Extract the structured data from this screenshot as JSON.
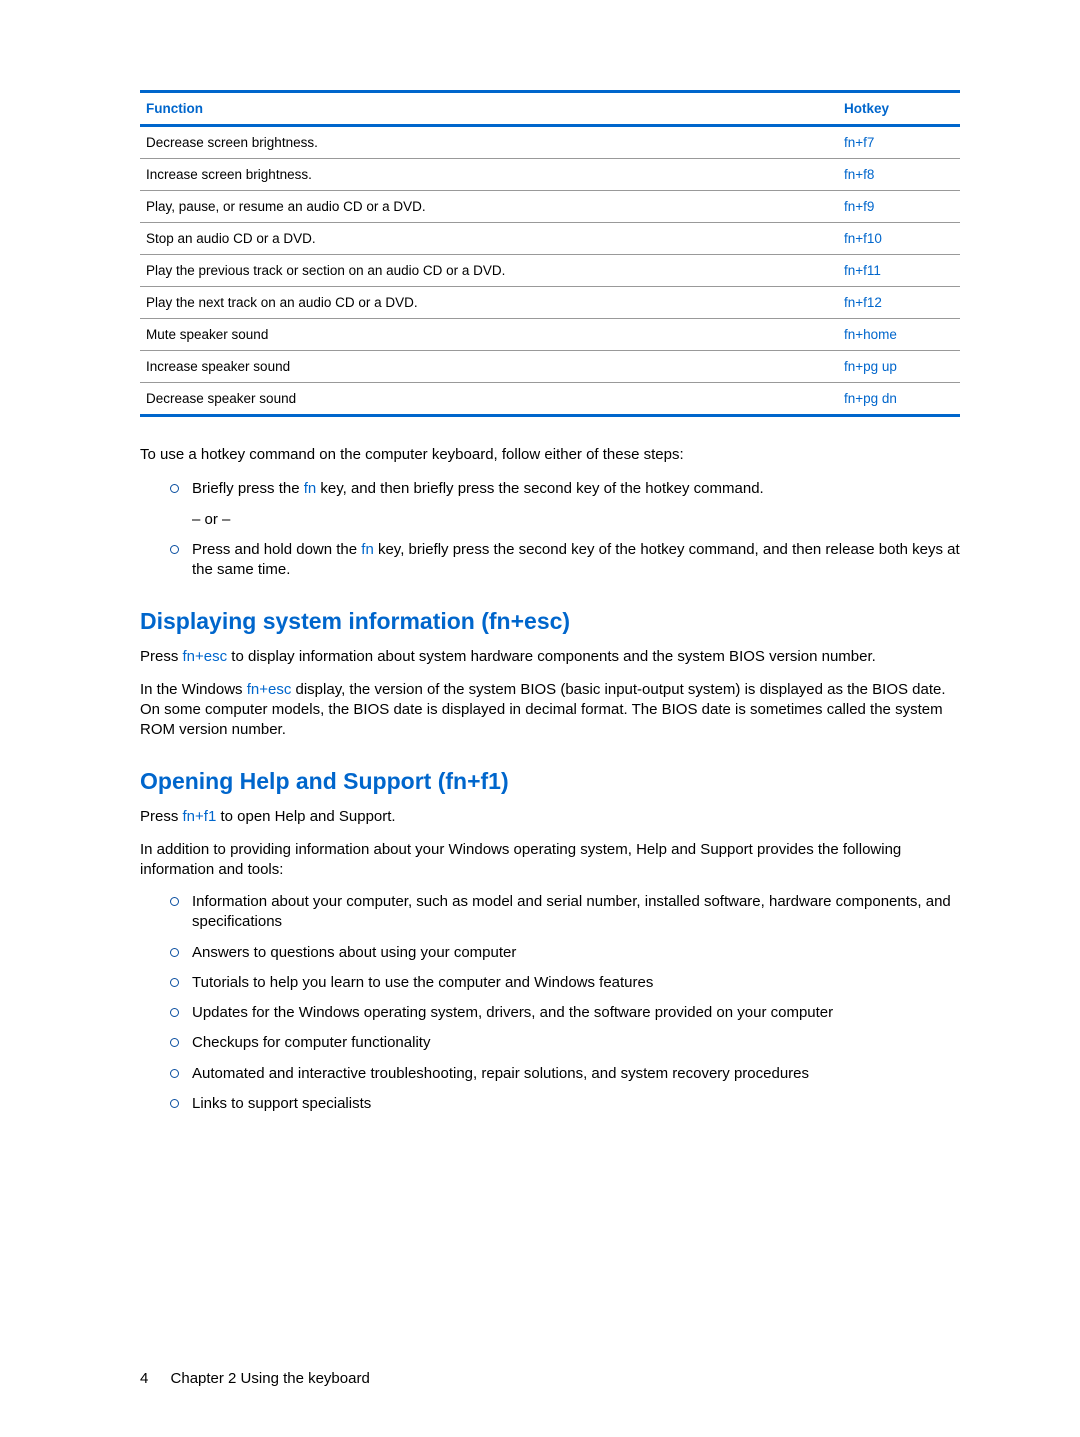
{
  "table": {
    "headers": {
      "function": "Function",
      "hotkey": "Hotkey"
    },
    "rows": [
      {
        "fn": "Decrease screen brightness.",
        "hk": "fn+f7"
      },
      {
        "fn": "Increase screen brightness.",
        "hk": "fn+f8"
      },
      {
        "fn": "Play, pause, or resume an audio CD or a DVD.",
        "hk": "fn+f9"
      },
      {
        "fn": "Stop an audio CD or a DVD.",
        "hk": "fn+f10"
      },
      {
        "fn": "Play the previous track or section on an audio CD or a DVD.",
        "hk": "fn+f11"
      },
      {
        "fn": "Play the next track on an audio CD or a DVD.",
        "hk": "fn+f12"
      },
      {
        "fn": "Mute speaker sound",
        "hk": "fn+home"
      },
      {
        "fn": "Increase speaker sound",
        "hk": "fn+pg up"
      },
      {
        "fn": "Decrease speaker sound",
        "hk": "fn+pg dn"
      }
    ]
  },
  "intro": "To use a hotkey command on the computer keyboard, follow either of these steps:",
  "steps": {
    "a_pre": "Briefly press the ",
    "a_fn": "fn",
    "a_post": " key, and then briefly press the second key of the hotkey command.",
    "or": "– or –",
    "b_pre": "Press and hold down the ",
    "b_fn": "fn",
    "b_post": " key, briefly press the second key of the hotkey command, and then release both keys at the same time."
  },
  "sec1": {
    "title": "Displaying system information (fn+esc)",
    "p1_pre": "Press ",
    "p1_hk": "fn+esc",
    "p1_post": " to display information about system hardware components and the system BIOS version number.",
    "p2_pre": "In the Windows ",
    "p2_hk": "fn+esc",
    "p2_post": " display, the version of the system BIOS (basic input-output system) is displayed as the BIOS date. On some computer models, the BIOS date is displayed in decimal format. The BIOS date is sometimes called the system ROM version number."
  },
  "sec2": {
    "title": "Opening Help and Support (fn+f1)",
    "p1_pre": "Press ",
    "p1_hk": "fn+f1",
    "p1_post": " to open Help and Support.",
    "p2": "In addition to providing information about your Windows operating system, Help and Support provides the following information and tools:",
    "items": [
      "Information about your computer, such as model and serial number, installed software, hardware components, and specifications",
      "Answers to questions about using your computer",
      "Tutorials to help you learn to use the computer and Windows features",
      "Updates for the Windows operating system, drivers, and the software provided on your computer",
      "Checkups for computer functionality",
      "Automated and interactive troubleshooting, repair solutions, and system recovery procedures",
      "Links to support specialists"
    ]
  },
  "footer": {
    "page": "4",
    "chapter": "Chapter 2   Using the keyboard"
  }
}
